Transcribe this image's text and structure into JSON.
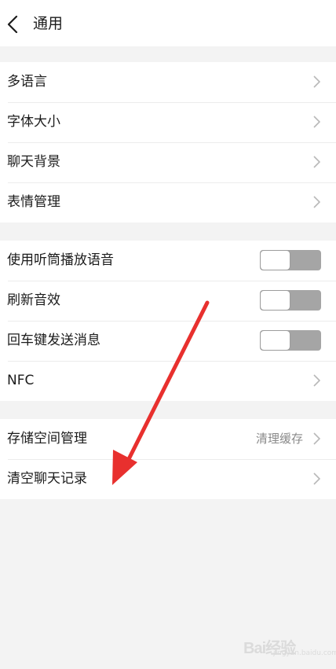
{
  "header": {
    "title": "通用",
    "back_icon": "chevron-left-icon"
  },
  "groups": [
    {
      "rows": [
        {
          "label": "多语言",
          "control": "chevron"
        },
        {
          "label": "字体大小",
          "control": "chevron"
        },
        {
          "label": "聊天背景",
          "control": "chevron"
        },
        {
          "label": "表情管理",
          "control": "chevron"
        }
      ]
    },
    {
      "rows": [
        {
          "label": "使用听筒播放语音",
          "control": "toggle",
          "on": false
        },
        {
          "label": "刷新音效",
          "control": "toggle",
          "on": false
        },
        {
          "label": "回车键发送消息",
          "control": "toggle",
          "on": false
        },
        {
          "label": "NFC",
          "control": "chevron"
        }
      ]
    },
    {
      "rows": [
        {
          "label": "存储空间管理",
          "value": "清理缓存",
          "control": "chevron"
        },
        {
          "label": "清空聊天记录",
          "control": "chevron"
        }
      ]
    }
  ],
  "annotation": {
    "type": "red-arrow",
    "points_to": "清空聊天记录",
    "color": "#e8302e"
  },
  "watermark": {
    "text": "Bai经验",
    "sub": "jingyan.baidu.com"
  },
  "colors": {
    "background": "#f3f3f3",
    "row_background": "#ffffff",
    "toggle_off": "#a5a5a5",
    "chevron": "#b8b8b8"
  }
}
